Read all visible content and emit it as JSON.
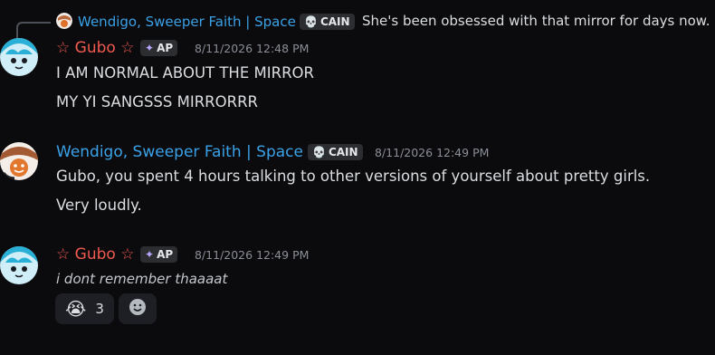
{
  "reply": {
    "author": "Wendigo, Sweeper Faith | Space",
    "tag": "CAIN",
    "text": "She's been obsessed with that mirror for days now."
  },
  "messages": [
    {
      "author": "☆ Gubo ☆",
      "author_color": "#f05a4f",
      "tag": "AP",
      "timestamp": "8/11/2026 12:48 PM",
      "lines": [
        "I AM NORMAL ABOUT THE MIRROR",
        "MY YI SANGSSS MIRRORRR"
      ]
    },
    {
      "author": "Wendigo, Sweeper Faith | Space",
      "author_color": "#3aa1e6",
      "tag": "CAIN",
      "timestamp": "8/11/2026 12:49 PM",
      "lines": [
        "Gubo, you spent 4 hours talking to other versions of yourself about pretty girls.",
        "Very loudly."
      ]
    },
    {
      "author": "☆ Gubo ☆",
      "author_color": "#f05a4f",
      "tag": "AP",
      "timestamp": "8/11/2026 12:49 PM",
      "lines": [
        "i dont remember thaaaat"
      ],
      "reactions": [
        {
          "icon": "crying-face-emoji",
          "count": "3"
        },
        {
          "icon": "add-reaction-icon"
        }
      ]
    }
  ]
}
